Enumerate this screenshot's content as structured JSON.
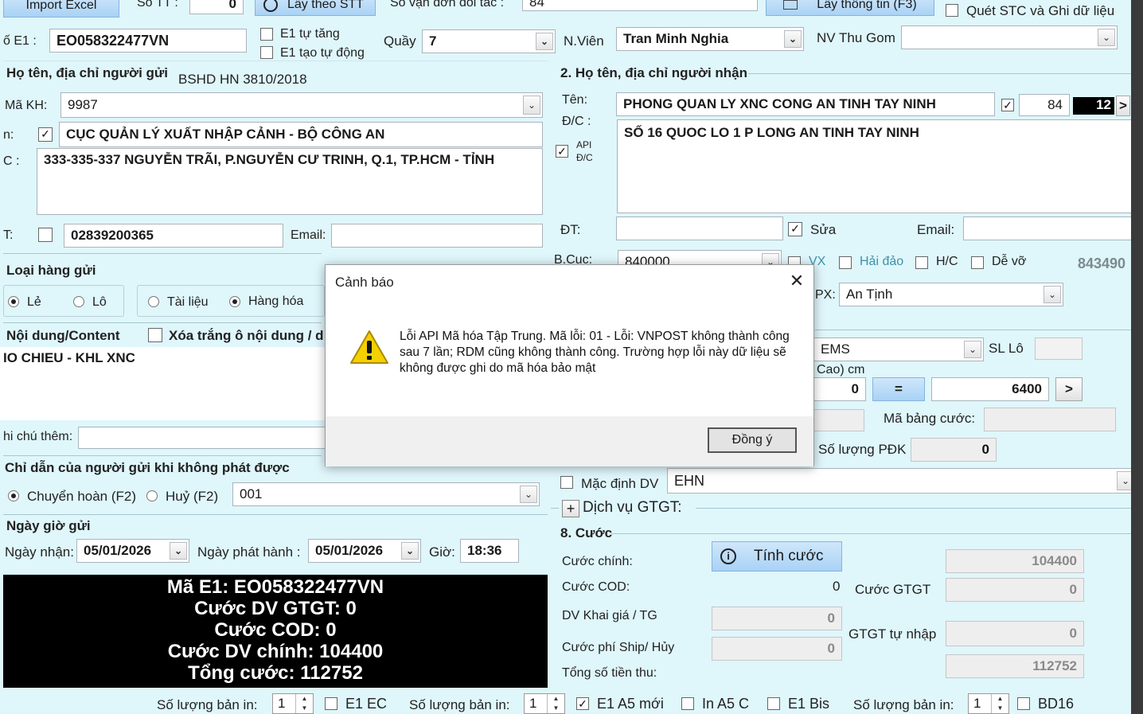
{
  "toolbar": {
    "import_excel": "Import Excel",
    "so_tt_label": "Số TT :",
    "so_tt_value": "0",
    "lay_theo_stt": "Lấy theo STT",
    "so_van_don_label": "Số vận đơn đối tác :",
    "so_van_don_value": "84",
    "lay_thong_tin": "Lấy thông tin (F3)",
    "quet_stc": "Quét STC và Ghi dữ liệu"
  },
  "row1": {
    "so_e1_label": "ố E1 :",
    "so_e1_value": "EO058322477VN",
    "e1_tu_tang": "E1 tự tăng",
    "e1_tao_tu_dong": "E1 tạo tự động",
    "quay_label": "Quầy",
    "quay_value": "7",
    "nvien_label": "N.Viên",
    "nvien_value": "Tran Minh Nghia",
    "nv_thu_gom_label": "NV Thu Gom",
    "nv_thu_gom_value": ""
  },
  "sender": {
    "section_title": "Họ tên, địa chỉ người gửi",
    "note": "BSHD HN 3810/2018",
    "ma_kh_label": "Mã KH:",
    "ma_kh_value": "9987",
    "name_label": "n:",
    "name_value": "CỤC QUẢN LÝ XUẤT NHẬP CẢNH - BỘ CÔNG AN",
    "address_label": "C :",
    "address_value": "333-335-337 NGUYỄN TRÃI, P.NGUYỄN CƯ TRINH, Q.1, TP.HCM - TỈNH",
    "phone_label": "T:",
    "phone_value": "02839200365",
    "email_label": "Email:",
    "email_value": ""
  },
  "recipient": {
    "section_title": "2. Họ tên, địa chỉ người nhận",
    "ten_label": "Tên:",
    "ten_value": "PHONG QUAN LY XNC CONG AN TINH TAY NINH",
    "dc_label": "Đ/C :",
    "api_label": "API",
    "api_dc_label": "Đ/C",
    "dc_value": "SỐ 16 QUOC LO 1 P LONG AN TINH TAY NINH",
    "count_value": "84",
    "count_black": "12",
    "next_btn": ">",
    "dt_label": "ĐT:",
    "dt_value": "",
    "sua_label": "Sửa",
    "email_label": "Email:",
    "email_value": "",
    "bcuc_label": "B.Cục:",
    "bcuc_value": "840000",
    "vx_label": "VX",
    "hai_dao_label": "Hải đảo",
    "hc_label": "H/C",
    "de_vo_label": "Dễ vỡ",
    "right_code": "843490",
    "px_label": "PX:",
    "px_value": "An Tịnh"
  },
  "goods": {
    "section_title": "Loại hàng gửi",
    "le": "Lẻ",
    "lo": "Lô",
    "tai_lieu": "Tài liệu",
    "hang_hoa": "Hàng hóa",
    "content_title": "Nội dung/Content",
    "xoa_trang": "Xóa trắng ô nội dung / d",
    "content_value": "IO CHIEU - KHL XNC",
    "ghi_chu_label": "hi chú thêm:",
    "ghi_chu_value": ""
  },
  "service": {
    "dich_vu_value": "EMS",
    "sl_lo_label": "SL Lô",
    "sl_lo_value": "",
    "cao_label": "Cao) cm",
    "dim_value": "0",
    "equal_btn": "=",
    "weight_value": "6400",
    "weight_next": ">",
    "ma_bang_cuoc_label": "Mã bảng cước:",
    "ma_bang_cuoc_value": "",
    "so_luong_pdk_label": "Số lượng PĐK",
    "so_luong_pdk_value": "0",
    "mac_dinh_dv": "Mặc định DV",
    "mac_dinh_value": "EHN",
    "dich_vu_gtgt": "Dịch vụ GTGT:",
    "plus_btn": "+"
  },
  "instructions": {
    "section_title": "Chỉ dẫn của người gửi khi không phát được",
    "chuyen_hoan": "Chuyển hoàn (F2)",
    "huy": "Huỷ (F2)",
    "code_value": "001"
  },
  "dates": {
    "section_title": "Ngày giờ gửi",
    "ngay_nhan_label": "Ngày nhận:",
    "ngay_nhan_value": "05/01/2026",
    "ngay_phat_hanh_label": "Ngày phát hành :",
    "ngay_phat_hanh_value": "05/01/2026",
    "gio_label": "Giờ:",
    "gio_value": "18:36"
  },
  "summary": {
    "line1": "Mã E1: EO058322477VN",
    "line2": "Cước DV GTGT: 0",
    "line3": "Cước COD: 0",
    "line4": "Cước DV chính: 104400",
    "line5": "Tổng cước: 112752"
  },
  "fees": {
    "section_title": "8. Cước",
    "cuoc_chinh_label": "Cước chính:",
    "tinh_cuoc_btn": "Tính cước",
    "cuoc_chinh_value": "104400",
    "cuoc_cod_label": "Cước COD:",
    "cuoc_cod_value": "0",
    "cuoc_gtgt_label": "Cước GTGT",
    "cuoc_gtgt_value": "0",
    "dv_khai_gia_label": "DV Khai giá / TG",
    "dv_khai_gia_value": "0",
    "gtgt_tu_nhap_label": "GTGT tự nhập",
    "gtgt_tu_nhap_value": "0",
    "cuoc_phi_ship_label": "Cước phí Ship/ Hủy",
    "cuoc_phi_ship_value": "0",
    "tong_so_tien_label": "Tổng số tiền thu:",
    "tong_so_tien_value": "112752"
  },
  "bottom": {
    "so_luong_ban_in_1": "Số lượng bản in:",
    "spin1": "1",
    "e1_ec": "E1 EC",
    "so_luong_ban_in_2": "Số lượng bản in:",
    "spin2": "1",
    "e1_a5_moi": "E1 A5 mới",
    "in_a5_c": "In A5 C",
    "e1_bis": "E1 Bis",
    "so_luong_ban_in_3": "Số lượng bản in:",
    "spin3": "1",
    "bd16": "BD16"
  },
  "dialog": {
    "title": "Cảnh báo",
    "message": "Lỗi API Mã hóa Tập Trung. Mã lỗi: 01 - Lỗi: VNPOST không thành công sau 7 lần; RDM cũng không thành công. Trường hợp lỗi này dữ liệu sẽ không được ghi do mã hóa bảo mật",
    "ok_button": "Đồng ý",
    "close_icon": "✕"
  }
}
